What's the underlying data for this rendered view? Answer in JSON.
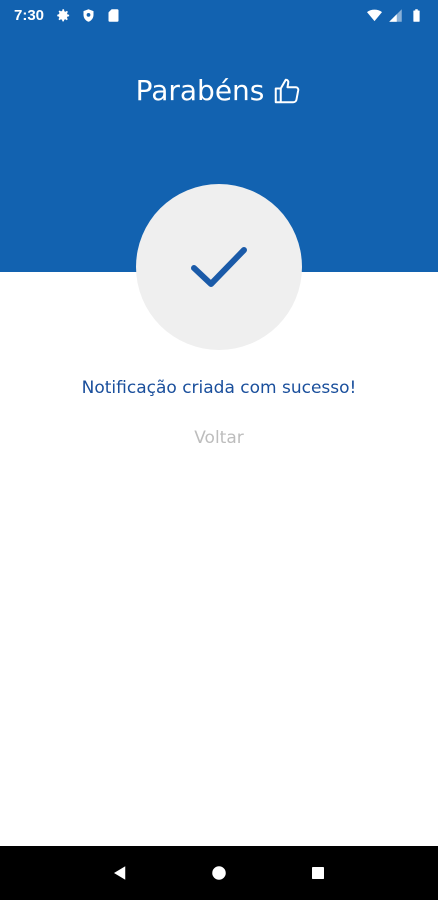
{
  "status_bar": {
    "time": "7:30",
    "left_icons": [
      "settings-icon",
      "shield-icon",
      "sim-card-icon"
    ],
    "right_icons": [
      "wifi-icon",
      "signal-icon",
      "battery-icon"
    ]
  },
  "header": {
    "title": "Parabéns",
    "title_icon": "thumbs-up-icon",
    "background_color": "#1262b0"
  },
  "success": {
    "icon": "checkmark-icon",
    "circle_color": "#efefef",
    "check_color": "#1a5aa8"
  },
  "message": "Notificação criada com sucesso!",
  "back_label": "Voltar",
  "nav_bar": {
    "buttons": [
      "back-icon",
      "home-icon",
      "recents-icon"
    ]
  }
}
